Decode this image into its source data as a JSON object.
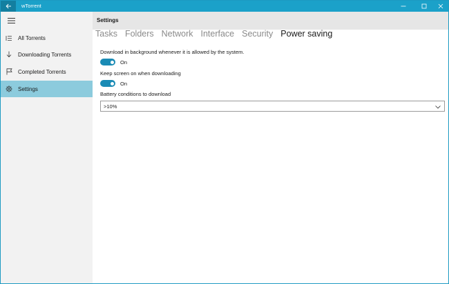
{
  "window": {
    "title": "wTorrent"
  },
  "sidebar": {
    "items": [
      {
        "label": "All Torrents",
        "icon": "list-icon"
      },
      {
        "label": "Downloading Torrents",
        "icon": "download-arrow-icon"
      },
      {
        "label": "Completed Torrents",
        "icon": "flag-icon"
      },
      {
        "label": "Settings",
        "icon": "gear-icon",
        "active": true
      }
    ]
  },
  "main": {
    "title": "Settings",
    "tabs": [
      {
        "label": "Tasks"
      },
      {
        "label": "Folders"
      },
      {
        "label": "Network"
      },
      {
        "label": "Interface"
      },
      {
        "label": "Security"
      },
      {
        "label": "Power saving",
        "active": true
      }
    ],
    "settings": {
      "background_label": "Download in background whenever it is allowed by the system.",
      "background_state": "On",
      "screen_label": "Keep screen on when downloading",
      "screen_state": "On",
      "battery_label": "Battery conditions to download",
      "battery_value": ">10%"
    }
  },
  "colors": {
    "titlebar": "#1ba1c9",
    "back_button": "#137fa0",
    "sidebar_active": "#8ccbdd",
    "toggle_on": "#1a8bb5"
  }
}
